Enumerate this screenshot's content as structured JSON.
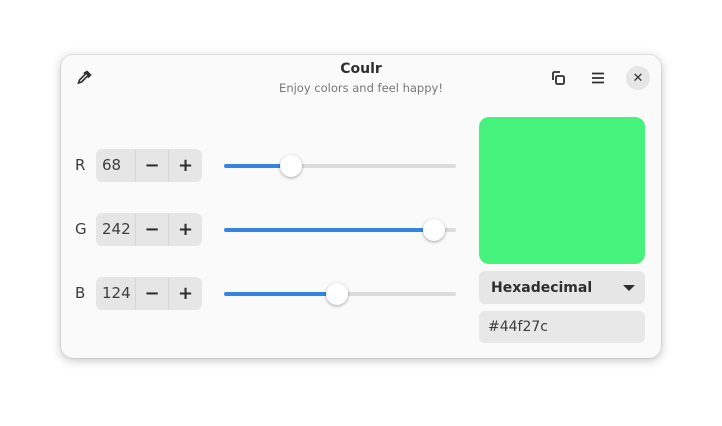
{
  "header": {
    "title": "Coulr",
    "subtitle": "Enjoy colors and feel happy!"
  },
  "channels": [
    {
      "label": "R",
      "value": 68,
      "minus": "−",
      "plus": "+"
    },
    {
      "label": "G",
      "value": 242,
      "minus": "−",
      "plus": "+"
    },
    {
      "label": "B",
      "value": 124,
      "minus": "−",
      "plus": "+"
    }
  ],
  "preview": {
    "color": "#44f27c"
  },
  "format": {
    "selected": "Hexadecimal"
  },
  "output": {
    "value": "#44f27c"
  },
  "colors": {
    "accent": "#3584e4"
  }
}
